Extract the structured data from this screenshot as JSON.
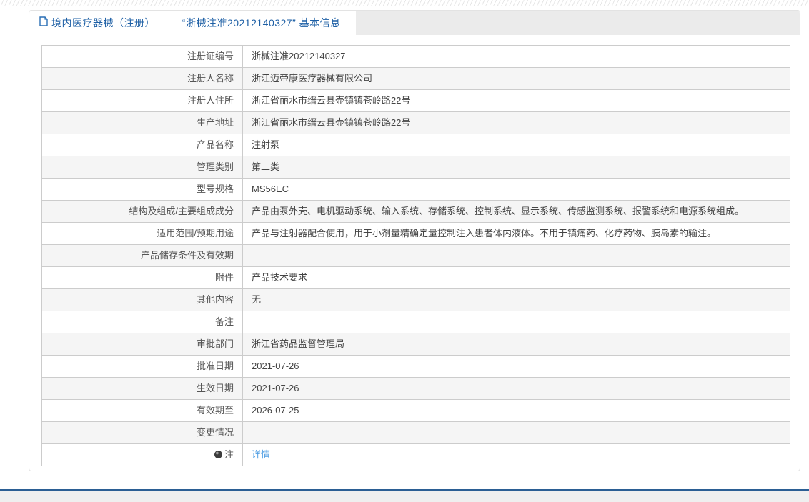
{
  "header": {
    "title": "境内医疗器械（注册） —— “浙械注准20212140327” 基本信息"
  },
  "table": {
    "rows": [
      {
        "label": "注册证编号",
        "value": "浙械注准20212140327"
      },
      {
        "label": "注册人名称",
        "value": "浙江迈帝康医疗器械有限公司"
      },
      {
        "label": "注册人住所",
        "value": "浙江省丽水市缙云县壶镇镇苍岭路22号"
      },
      {
        "label": "生产地址",
        "value": "浙江省丽水市缙云县壶镇镇苍岭路22号"
      },
      {
        "label": "产品名称",
        "value": "注射泵"
      },
      {
        "label": "管理类别",
        "value": "第二类"
      },
      {
        "label": "型号规格",
        "value": "MS56EC"
      },
      {
        "label": "结构及组成/主要组成成分",
        "value": "产品由泵外壳、电机驱动系统、输入系统、存储系统、控制系统、显示系统、传感监测系统、报警系统和电源系统组成。"
      },
      {
        "label": "适用范围/预期用途",
        "value": "产品与注射器配合使用，用于小剂量精确定量控制注入患者体内液体。不用于镇痛药、化疗药物、胰岛素的输注。"
      },
      {
        "label": "产品储存条件及有效期",
        "value": ""
      },
      {
        "label": "附件",
        "value": "产品技术要求"
      },
      {
        "label": "其他内容",
        "value": "无"
      },
      {
        "label": "备注",
        "value": ""
      },
      {
        "label": "审批部门",
        "value": "浙江省药品监督管理局"
      },
      {
        "label": "批准日期",
        "value": "2021-07-26"
      },
      {
        "label": "生效日期",
        "value": "2021-07-26"
      },
      {
        "label": "有效期至",
        "value": "2026-07-25"
      },
      {
        "label": "变更情况",
        "value": ""
      },
      {
        "label": "注",
        "value": "详情",
        "value_is_link": true,
        "label_icon": "note-icon"
      }
    ]
  },
  "colors": {
    "title_blue": "#1d5fa5",
    "link_blue": "#4f9ee3",
    "header_strip_gray": "#ebebeb",
    "table_border": "#cccccc",
    "alt_row_gray": "#f5f5f5",
    "footer_line_blue": "#2b5e94",
    "footer_band_gray": "#efefef"
  }
}
